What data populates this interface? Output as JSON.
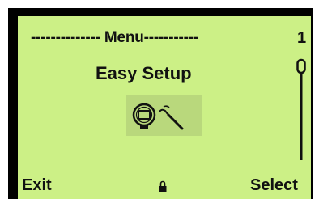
{
  "screen": {
    "menu_title": "-------------- Menu-----------",
    "page_number": "1",
    "item_label": "Easy Setup",
    "item_icon": "device-wrench-icon",
    "lock_icon": "padlock-icon"
  },
  "softkeys": {
    "left_label": "Exit",
    "right_label": "Select"
  },
  "colors": {
    "frame": "#000000",
    "lcd_background": "#ccf086",
    "icon_highlight": "#b9d87c",
    "text": "#111111"
  }
}
